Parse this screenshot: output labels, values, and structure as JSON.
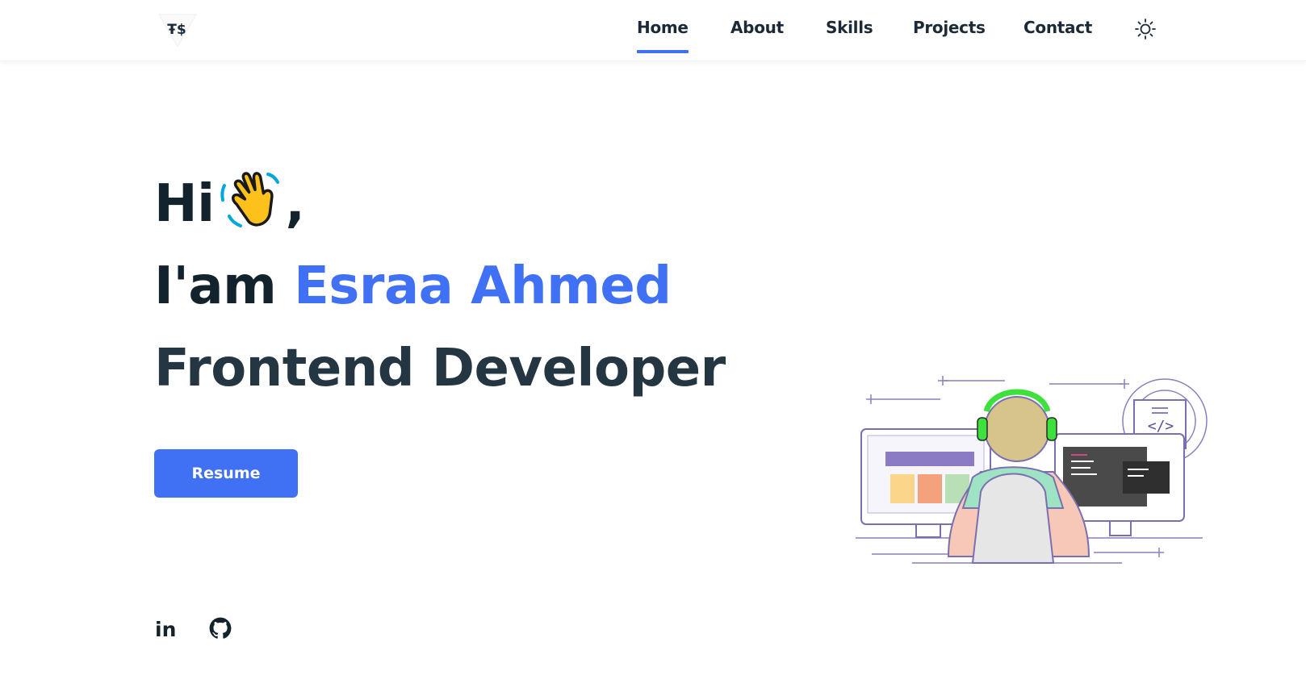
{
  "nav": {
    "logo_glyph": "Ŧ$",
    "links": [
      {
        "label": "Home",
        "active": true
      },
      {
        "label": "About",
        "active": false
      },
      {
        "label": "Skills",
        "active": false
      },
      {
        "label": "Projects",
        "active": false
      },
      {
        "label": "Contact",
        "active": false
      }
    ],
    "theme_icon": "sun-icon"
  },
  "hero": {
    "greeting": "Hi",
    "greeting_suffix": ",",
    "wave_icon": "waving-hand-icon",
    "intro": "I'am",
    "name": "Esraa Ahmed",
    "role": "Frontend Developer",
    "resume_label": "Resume",
    "illustration": "developer-at-desk-illustration"
  },
  "socials": [
    {
      "icon": "linkedin-icon",
      "label": "in"
    },
    {
      "icon": "github-icon"
    }
  ],
  "colors": {
    "accent": "#4070f4",
    "heading": "#12232e",
    "text": "#1b2a36",
    "background": "#ffffff"
  }
}
